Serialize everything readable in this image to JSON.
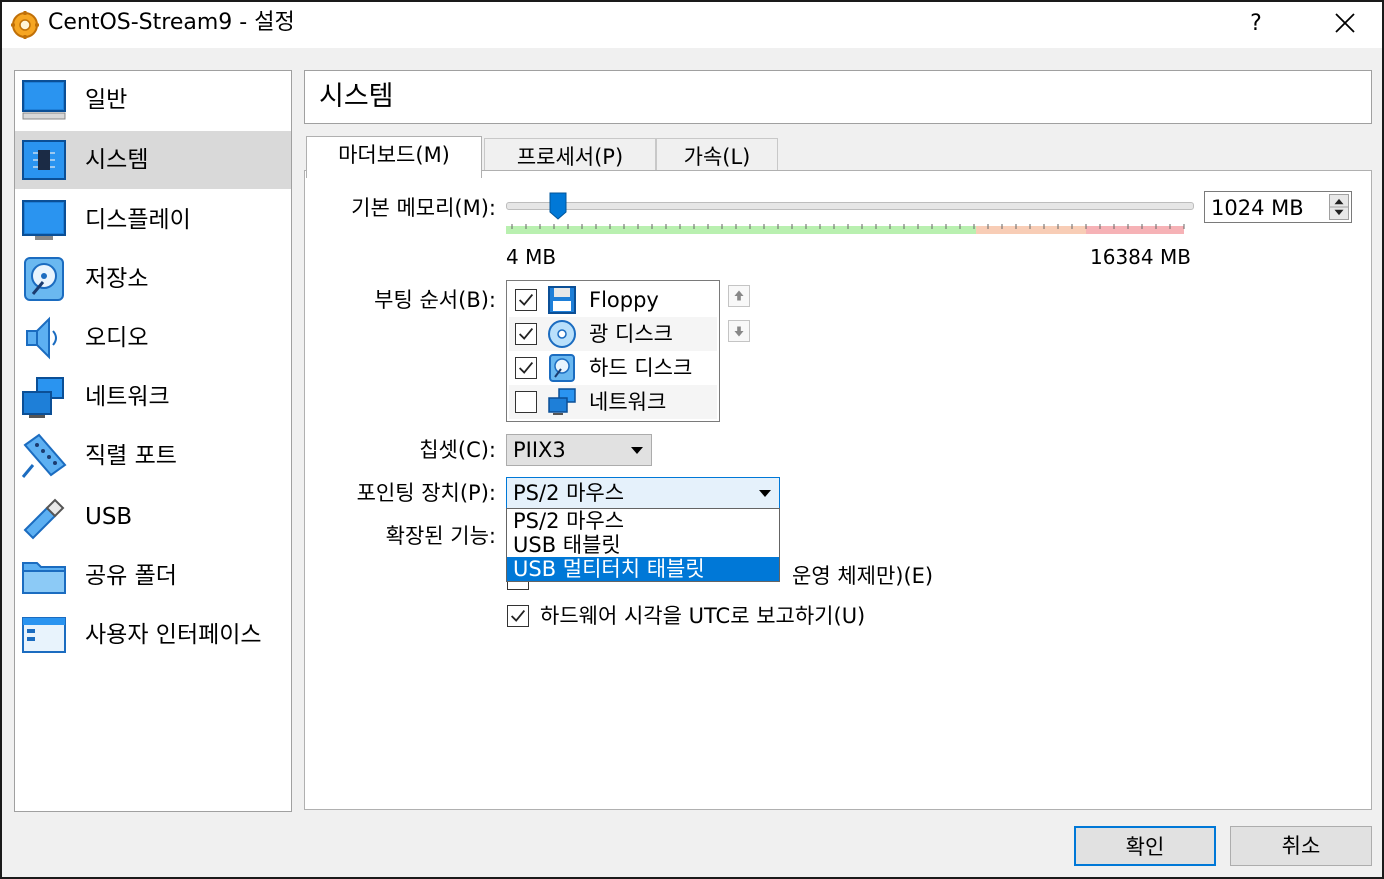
{
  "window": {
    "title": "CentOS-Stream9 - 설정",
    "help": "?",
    "app_icon": "virtualbox-gear-icon",
    "close_icon": "close-icon"
  },
  "sidebar": {
    "items": [
      {
        "label": "일반",
        "icon": "general-monitor-icon"
      },
      {
        "label": "시스템",
        "icon": "system-chip-icon"
      },
      {
        "label": "디스플레이",
        "icon": "display-monitor-icon"
      },
      {
        "label": "저장소",
        "icon": "storage-disk-icon"
      },
      {
        "label": "오디오",
        "icon": "audio-speaker-icon"
      },
      {
        "label": "네트워크",
        "icon": "network-icon"
      },
      {
        "label": "직렬 포트",
        "icon": "serial-port-icon"
      },
      {
        "label": "USB",
        "icon": "usb-icon"
      },
      {
        "label": "공유 폴더",
        "icon": "shared-folder-icon"
      },
      {
        "label": "사용자 인터페이스",
        "icon": "user-interface-icon"
      }
    ],
    "selected": "시스템"
  },
  "header": {
    "title": "시스템"
  },
  "tabs": [
    {
      "label": "마더보드(M)",
      "active": true
    },
    {
      "label": "프로세서(P)",
      "active": false
    },
    {
      "label": "가속(L)",
      "active": false
    }
  ],
  "motherboard": {
    "memory": {
      "label": "기본 메모리(M):",
      "value_text": "1024 MB",
      "value_mb": 1024,
      "min_label": "4 MB",
      "max_label": "16384 MB"
    },
    "boot": {
      "label": "부팅 순서(B):",
      "items": [
        {
          "label": "Floppy",
          "checked": true,
          "icon": "floppy-icon"
        },
        {
          "label": "광 디스크",
          "checked": true,
          "icon": "optical-disc-icon"
        },
        {
          "label": "하드 디스크",
          "checked": true,
          "icon": "hard-disk-icon"
        },
        {
          "label": "네트워크",
          "checked": false,
          "icon": "network-icon"
        }
      ],
      "up_icon": "move-up-icon",
      "down_icon": "move-down-icon"
    },
    "chipset": {
      "label": "칩셋(C):",
      "value": "PIIX3"
    },
    "pointing": {
      "label": "포인팅 장치(P):",
      "value": "PS/2 마우스",
      "options": [
        "PS/2 마우스",
        "USB 태블릿",
        "USB 멀티터치 태블릿"
      ],
      "highlighted": "USB 멀티터치 태블릿"
    },
    "features": {
      "label": "확장된 기능:",
      "efi_visible_text": "운영 체제만)(E)",
      "utc_label": "하드웨어 시각을 UTC로 보고하기(U)",
      "utc_checked": true
    }
  },
  "buttons": {
    "ok": "확인",
    "cancel": "취소"
  },
  "colors": {
    "accent": "#0078d7",
    "slider_green": "#b9f0b0",
    "slider_orange": "#f8cdb6",
    "slider_red": "#f6b2b6"
  }
}
